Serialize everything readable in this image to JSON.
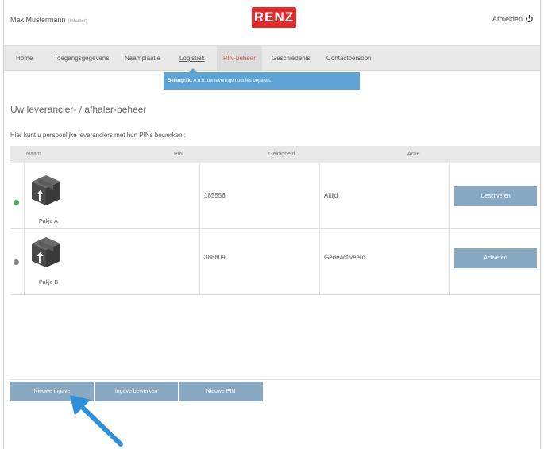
{
  "header": {
    "user_name": "Max Mustermann",
    "user_sub": "(Inhaber)",
    "logo": "RENZ",
    "logout": "Afmelden"
  },
  "nav": {
    "items": [
      {
        "label": "Home"
      },
      {
        "label": "Toegangsgegevens"
      },
      {
        "label": "Naamplaatje"
      },
      {
        "label": "Logistiek"
      },
      {
        "label": "PIN-beheer"
      },
      {
        "label": "Geschiedenis"
      },
      {
        "label": "Contactpersoon"
      }
    ]
  },
  "tooltip": {
    "bold": "Belangrijk:",
    "text": "A.u.b. uw leveringsmodules bepalen."
  },
  "page": {
    "title": "Uw leverancier- / afhaler-beheer",
    "intro": "Hier kunt u persoonlijke leveranciers met hun PINs bewerken.:"
  },
  "table": {
    "headers": [
      "Naam",
      "PIN",
      "Geldigheid",
      "Actie"
    ],
    "rows": [
      {
        "name": "Pakje A",
        "pin": "185556",
        "validity": "Altijd",
        "action": "Deactiveren",
        "status_color": "#4caf50"
      },
      {
        "name": "Pakje B",
        "pin": "388809",
        "validity": "Gedeactiveerd",
        "action": "Activeren",
        "status_color": "#888888"
      }
    ]
  },
  "buttons": {
    "new_entry": "Nieuwe ingave",
    "edit_entry": "Ingave bewerken",
    "new_pin": "Nieuwe PIN"
  },
  "colors": {
    "accent": "#89a9c3",
    "tooltip": "#5ea3d6",
    "logo": "#e32b2b",
    "active_nav": "#c55a5a",
    "pointer": "#2f8fd8"
  },
  "icons": {
    "logout": "power-icon",
    "package": "package-icon",
    "pointer": "arrow-pointer-icon"
  }
}
